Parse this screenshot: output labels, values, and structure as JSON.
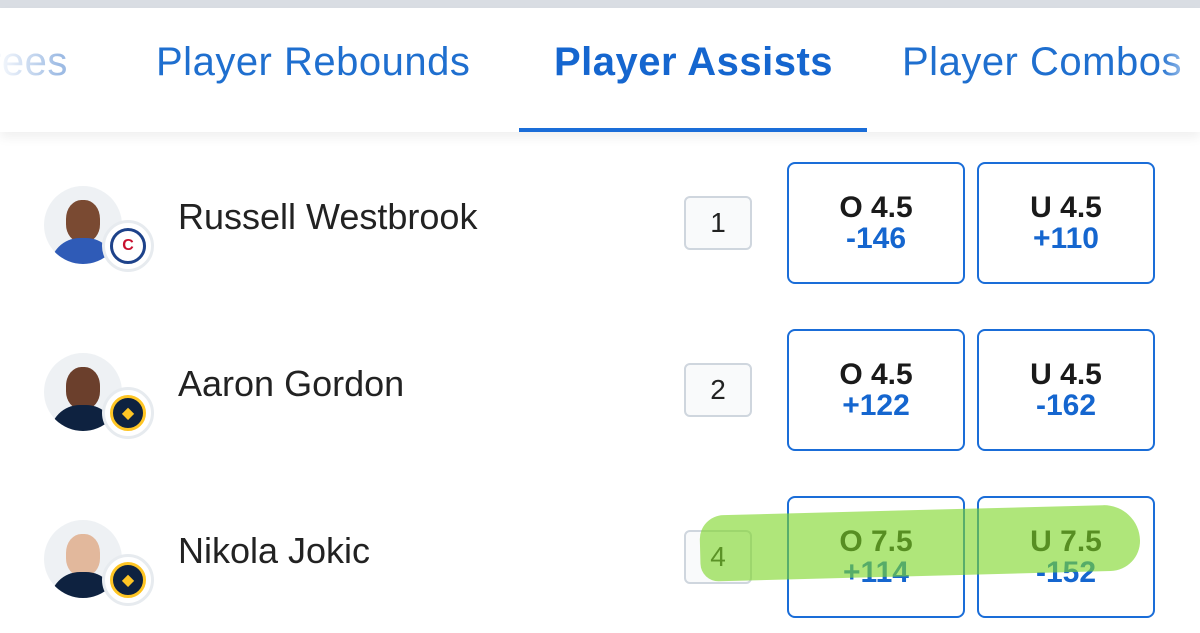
{
  "tabs": [
    {
      "label": "rees"
    },
    {
      "label": "Player Rebounds"
    },
    {
      "label": "Player Assists"
    },
    {
      "label": "Player Combos"
    }
  ],
  "active_tab": "Player Assists",
  "rows": [
    {
      "name": "Russell Westbrook",
      "rank": "1",
      "team_logo": "clippers-logo",
      "over": {
        "line": "O 4.5",
        "price": "-146"
      },
      "under": {
        "line": "U 4.5",
        "price": "+110"
      }
    },
    {
      "name": "Aaron Gordon",
      "rank": "2",
      "team_logo": "nuggets-logo",
      "over": {
        "line": "O 4.5",
        "price": "+122"
      },
      "under": {
        "line": "U 4.5",
        "price": "-162"
      }
    },
    {
      "name": "Nikola Jokic",
      "rank": "4",
      "team_logo": "nuggets-logo",
      "over": {
        "line": "O 7.5",
        "price": "+114"
      },
      "under": {
        "line": "U 7.5",
        "price": "-152"
      }
    }
  ],
  "colors": {
    "accent": "#1566cf",
    "highlight": "#7ed628"
  }
}
